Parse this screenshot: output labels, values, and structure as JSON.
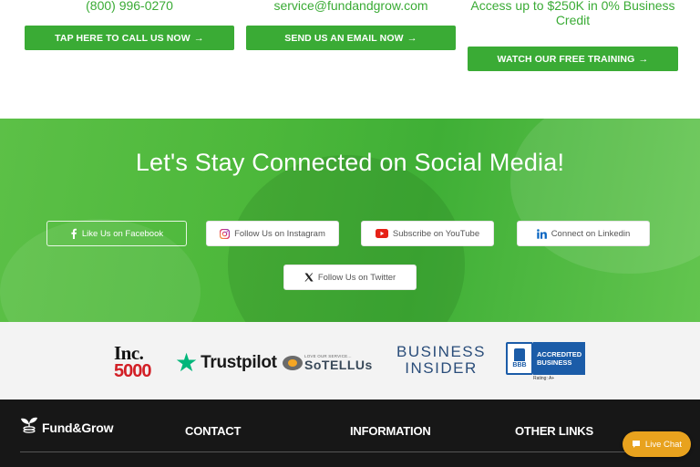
{
  "contact": {
    "phone": "(800) 996-0270",
    "email": "service@fundandgrow.com",
    "credit_line1": "Access up to $250K in 0% Business",
    "credit_line2": "Credit",
    "call_button": "TAP HERE TO CALL US NOW",
    "email_button": "SEND US AN EMAIL NOW",
    "training_button": "WATCH OUR FREE TRAINING",
    "accent_color": "#3aab35"
  },
  "social": {
    "title": "Let's Stay Connected on Social Media!",
    "buttons": [
      {
        "label": "Like Us on Facebook",
        "icon": "facebook-icon"
      },
      {
        "label": "Follow Us on Instagram",
        "icon": "instagram-icon"
      },
      {
        "label": "Subscribe on YouTube",
        "icon": "youtube-icon"
      },
      {
        "label": "Connect on Linkedin",
        "icon": "linkedin-icon"
      },
      {
        "label": "Follow Us on Twitter",
        "icon": "x-twitter-icon"
      }
    ]
  },
  "logos": {
    "inc_line1": "Inc.",
    "inc_line2": "5000",
    "trustpilot": "Trustpilot",
    "sotellus_small": "LOVE OUR SERVICE...",
    "sotellus": "SoTELLUs",
    "business_insider_line1": "BUSINESS",
    "business_insider_line2": "INSIDER",
    "bbb_seal": "BBB",
    "bbb_line1": "ACCREDITED",
    "bbb_line2": "BUSINESS",
    "bbb_rating": "Rating: A+"
  },
  "footer": {
    "brand": "Fund&Grow",
    "headings": [
      "CONTACT",
      "INFORMATION",
      "OTHER LINKS"
    ]
  },
  "chat": {
    "label": "Live Chat",
    "color": "#e8a21e"
  }
}
